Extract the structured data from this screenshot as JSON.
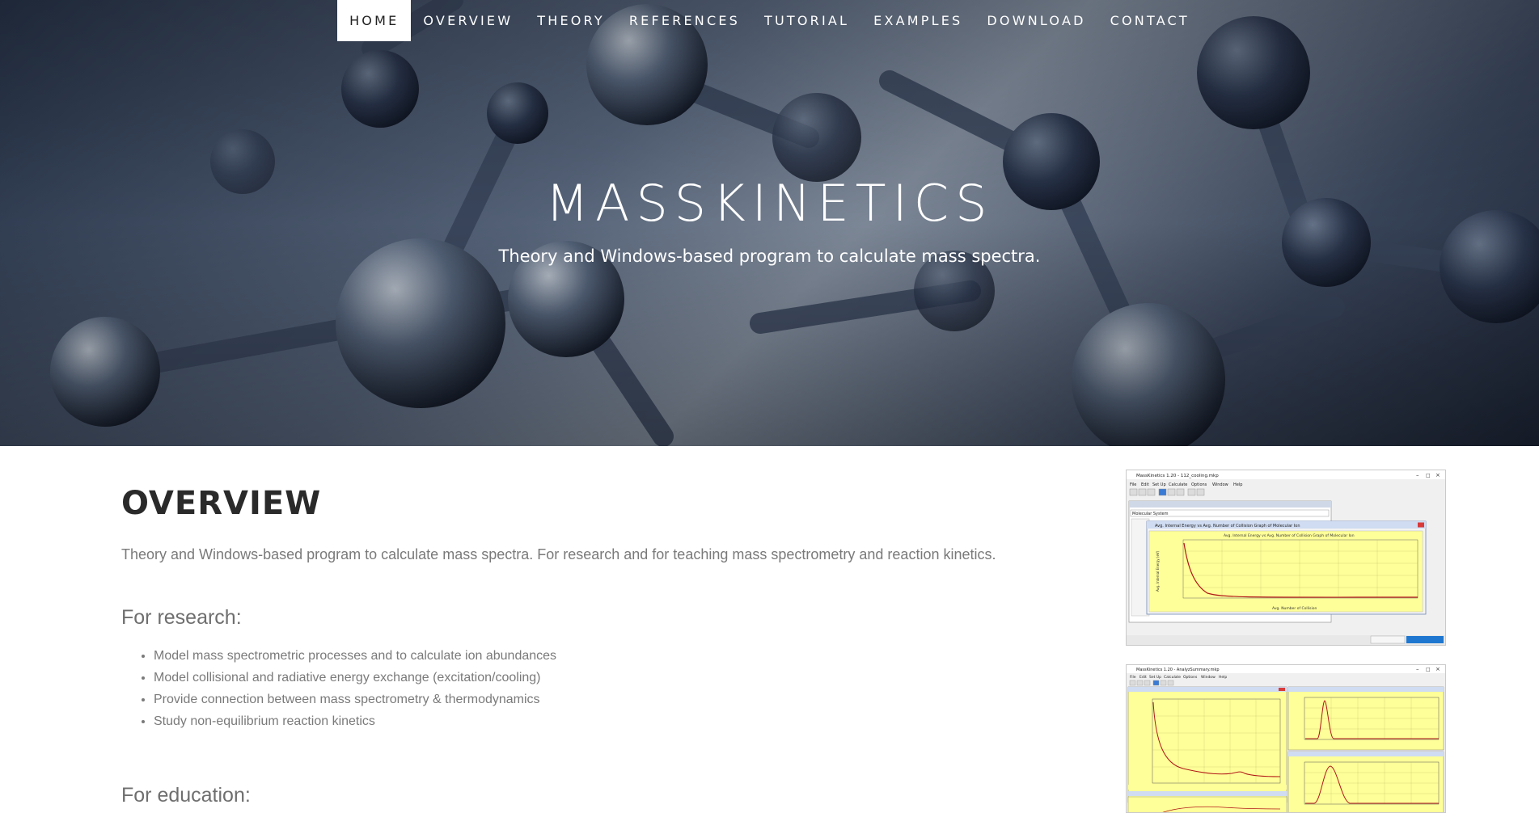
{
  "nav": {
    "items": [
      {
        "label": "HOME",
        "active": true
      },
      {
        "label": "OVERVIEW",
        "active": false
      },
      {
        "label": "THEORY",
        "active": false
      },
      {
        "label": "REFERENCES",
        "active": false
      },
      {
        "label": "TUTORIAL",
        "active": false
      },
      {
        "label": "EXAMPLES",
        "active": false
      },
      {
        "label": "DOWNLOAD",
        "active": false
      },
      {
        "label": "CONTACT",
        "active": false
      }
    ]
  },
  "hero": {
    "title": "MASSKINETICS",
    "subtitle": "Theory and Windows-based program to calculate mass spectra."
  },
  "overview": {
    "title": "OVERVIEW",
    "intro": "Theory and Windows-based program to calculate mass spectra. For research and for teaching mass spectrometry and reaction kinetics.",
    "research": {
      "heading": "For research:",
      "items": [
        "Model mass spectrometric processes and to calculate ion abundances",
        "Model collisional and radiative energy exchange (excitation/cooling)",
        "Provide connection between mass spectrometry & thermodynamics",
        "Study non-equilibrium reaction kinetics"
      ]
    },
    "education": {
      "heading": "For education:"
    }
  },
  "screenshots": {
    "shot1": {
      "window_title": "MassKinetics 1.20 - 112_cooling.mkp",
      "menu": [
        "File",
        "Edit",
        "Set Up",
        "Calculate",
        "Options",
        "Window",
        "Help"
      ],
      "chart_window_title": "Avg. Internal Energy vs Avg. Number of Collision Graph of Molecular Ion",
      "chart_title": "Avg. Internal Energy vs Avg. Number of Collision Graph of Molecular Ion",
      "xlabel": "Avg. Number of Collision",
      "ylabel": "Avg. Internal Energy (eV)",
      "panel_label": "Molecular System"
    },
    "shot2": {
      "window_title": "MassKinetics 1.20 - AnalyzSummary.mkp",
      "menu": [
        "File",
        "Edit",
        "Set Up",
        "Calculate",
        "Options",
        "Window",
        "Help"
      ]
    }
  },
  "colors": {
    "hero_dark": "#27344a",
    "chart_bg": "#ffff99",
    "curve": "#b01818",
    "text_gray": "#7a7a7a"
  }
}
